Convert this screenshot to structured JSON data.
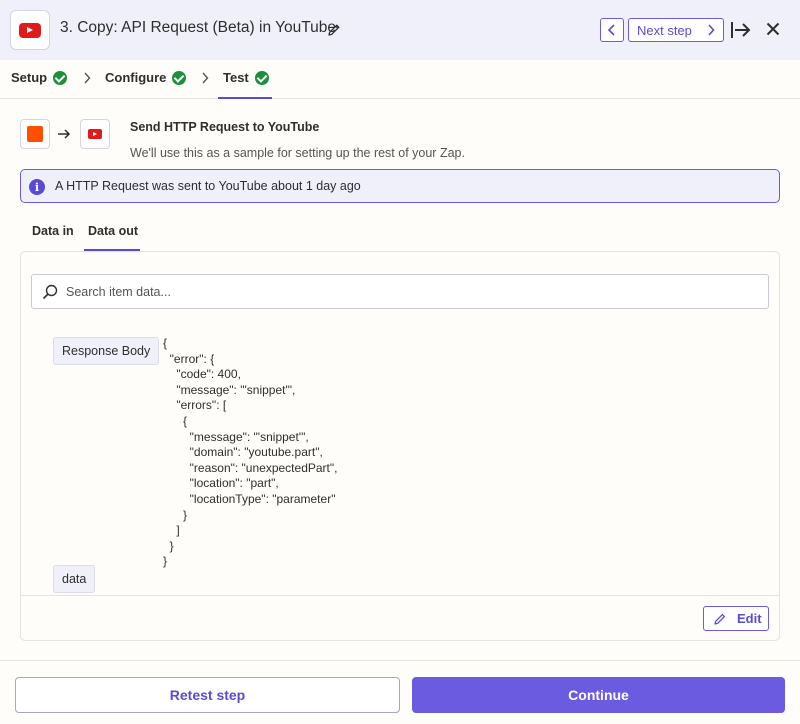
{
  "header": {
    "title": "3. Copy: API Request (Beta) in YouTube",
    "app_icon": "youtube-logo",
    "next_step_label": "Next step",
    "icons": [
      "pencil-icon",
      "chevron-left-icon",
      "chevron-right-icon",
      "exit-panel-icon",
      "close-icon"
    ]
  },
  "steps": [
    {
      "label": "Setup",
      "status": "complete"
    },
    {
      "label": "Configure",
      "status": "complete"
    },
    {
      "label": "Test",
      "status": "complete",
      "active": true
    }
  ],
  "request": {
    "title": "Send HTTP Request to YouTube",
    "subtitle": "We'll use this as a sample for setting up the rest of your Zap."
  },
  "info_banner": {
    "icon_text": "i",
    "text": "A HTTP Request was sent to YouTube about 1 day ago"
  },
  "data_tabs": [
    {
      "label": "Data in",
      "active": false
    },
    {
      "label": "Data out",
      "active": true
    }
  ],
  "search": {
    "placeholder": "Search item data..."
  },
  "data_out": {
    "response_body_key": "Response Body",
    "response_body_value": "{\n  \"error\": {\n    \"code\": 400,\n    \"message\": \"'snippet'\",\n    \"errors\": [\n      {\n        \"message\": \"'snippet'\",\n        \"domain\": \"youtube.part\",\n        \"reason\": \"unexpectedPart\",\n        \"location\": \"part\",\n        \"locationType\": \"parameter\"\n      }\n    ]\n  }\n}",
    "data_key": "data"
  },
  "edit_label": "Edit",
  "footer": {
    "retest_label": "Retest step",
    "continue_label": "Continue"
  },
  "colors": {
    "accent": "#6a5be0",
    "success": "#1c8f3f",
    "youtube_red": "#e11a1a",
    "zapier_orange": "#ff4f00",
    "header_bg": "#f0f0fb"
  }
}
